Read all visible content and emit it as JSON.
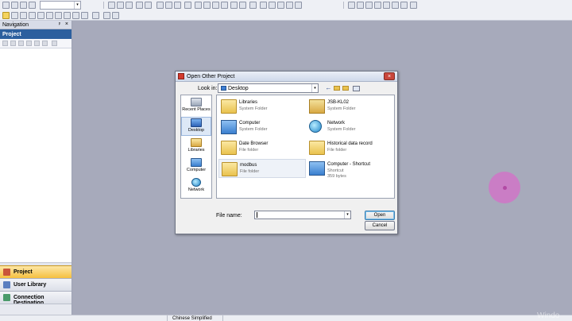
{
  "navigation": {
    "title": "Navigation",
    "pin_glyph": "ᵖ",
    "close_glyph": "×",
    "section": "Project",
    "tabs": [
      {
        "label": "Project",
        "icon": "project-icon",
        "active": true
      },
      {
        "label": "User Library",
        "icon": "user-library-icon",
        "active": false
      },
      {
        "label": "Connection Destination",
        "icon": "connection-icon",
        "active": false
      }
    ]
  },
  "dialog": {
    "title": "Open Other Project",
    "close_glyph": "×",
    "look_in_label": "Look in:",
    "look_in_value": "Desktop",
    "places": [
      {
        "label": "Recent Places",
        "icon": "recent-places-icon",
        "selected": false
      },
      {
        "label": "Desktop",
        "icon": "desktop-icon",
        "selected": true
      },
      {
        "label": "Libraries",
        "icon": "libraries-icon",
        "selected": false
      },
      {
        "label": "Computer",
        "icon": "computer-icon",
        "selected": false
      },
      {
        "label": "Network",
        "icon": "network-icon",
        "selected": false
      }
    ],
    "items": [
      {
        "name": "Libraries",
        "type": "System Folder",
        "extra": "",
        "icon": "libraries-folder-icon"
      },
      {
        "name": "JSB-KL02",
        "type": "System Folder",
        "extra": "",
        "icon": "user-folder-icon"
      },
      {
        "name": "Computer",
        "type": "System Folder",
        "extra": "",
        "icon": "computer-icon"
      },
      {
        "name": "Network",
        "type": "System Folder",
        "extra": "",
        "icon": "network-icon"
      },
      {
        "name": "Date Browser",
        "type": "File folder",
        "extra": "",
        "icon": "folder-icon"
      },
      {
        "name": "Historical data record",
        "type": "File folder",
        "extra": "",
        "icon": "folder-icon"
      },
      {
        "name": "modbus",
        "type": "File folder",
        "extra": "",
        "icon": "folder-icon"
      },
      {
        "name": "Computer - Shortcut",
        "type": "Shortcut",
        "extra": "359 bytes",
        "icon": "shortcut-icon"
      }
    ],
    "file_name_label": "File name:",
    "file_name_value": "",
    "open_button": "Open",
    "cancel_button": "Cancel",
    "dropdown_glyph": "▾"
  },
  "status_bar": {
    "language": "Chinese Simplified"
  },
  "watermark": "Windo",
  "toolbar": {
    "dropdown_glyph": "▾"
  }
}
